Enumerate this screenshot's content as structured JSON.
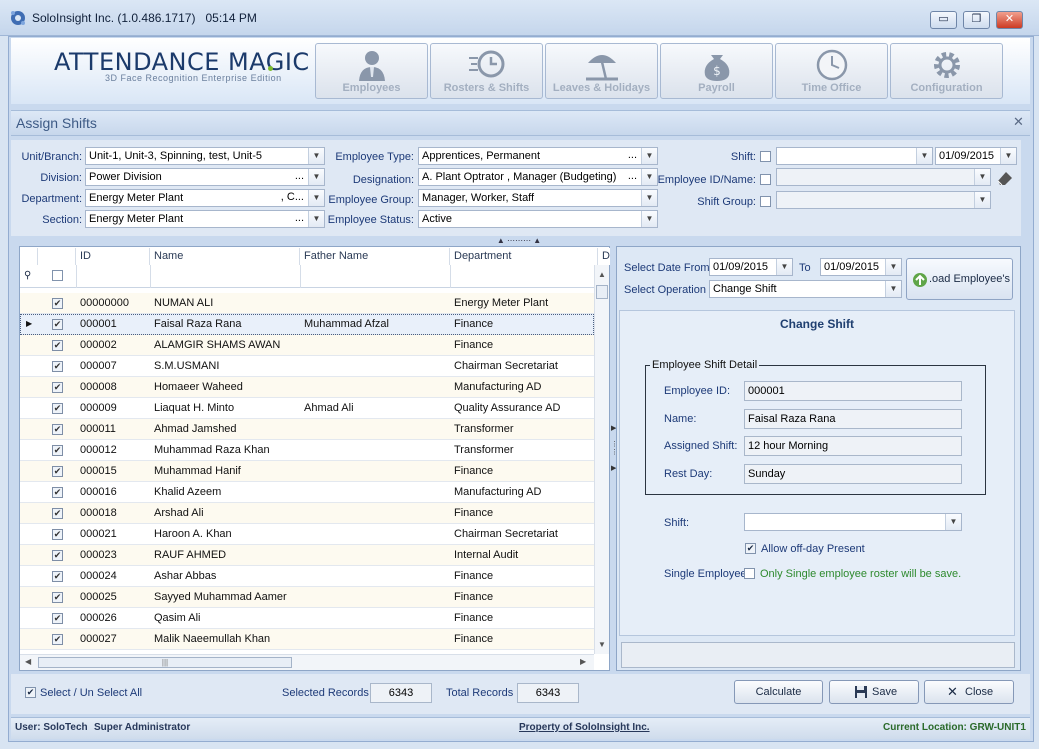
{
  "window": {
    "title": "SoloInsight Inc. (1.0.486.1717)",
    "time": "05:14 PM",
    "minimize": "▭",
    "restore": "❐",
    "close": "✕"
  },
  "brand": {
    "title": "ATTENDANCE MAGIC",
    "subtitle": "3D Face Recognition Enterprise Edition"
  },
  "nav": [
    {
      "label": "Employees",
      "icon": "employee-icon"
    },
    {
      "label": "Rosters & Shifts",
      "icon": "roster-clock-icon"
    },
    {
      "label": "Leaves & Holidays",
      "icon": "beach-umbrella-icon"
    },
    {
      "label": "Payroll",
      "icon": "money-bag-icon"
    },
    {
      "label": "Time Office",
      "icon": "wall-clock-icon"
    },
    {
      "label": "Configuration",
      "icon": "gear-icon"
    }
  ],
  "page": {
    "title": "Assign Shifts",
    "close": "✕"
  },
  "filters": {
    "unit_label": "Unit/Branch:",
    "unit_value": "Unit-1, Unit-3, Spinning, test, Unit-5",
    "division_label": "Division:",
    "division_value": "Power Division",
    "division_dots": "...",
    "department_label": "Department:",
    "department_value": "Energy Meter Plant",
    "department_more": ", C...",
    "section_label": "Section:",
    "section_value": "Energy Meter Plant",
    "section_dots": "...",
    "emp_type_label": "Employee Type:",
    "emp_type_value": "Apprentices, Permanent",
    "emp_type_dots": "...",
    "designation_label": "Designation:",
    "designation_value": "A. Plant Optrator , Manager (Budgeting)",
    "designation_dots": "...",
    "emp_group_label": "Employee Group:",
    "emp_group_value": "Manager, Worker, Staff",
    "emp_status_label": "Employee Status:",
    "emp_status_value": "Active",
    "shift_label": "Shift:",
    "shift_value": "",
    "shift_date": "01/09/2015",
    "emp_id_label": "Employee ID/Name:",
    "shift_group_label": "Shift Group:"
  },
  "grid": {
    "columns": [
      "ID",
      "Name",
      "Father Name",
      "Department",
      "D"
    ],
    "rows": [
      {
        "id": "00000000",
        "name": "NUMAN ALI",
        "father": "",
        "dept": "Energy Meter Plant"
      },
      {
        "id": "000001",
        "name": "Faisal Raza Rana",
        "father": "Muhammad Afzal",
        "dept": "Finance"
      },
      {
        "id": "000002",
        "name": "ALAMGIR SHAMS AWAN",
        "father": "",
        "dept": "Finance"
      },
      {
        "id": "000007",
        "name": "S.M.USMANI",
        "father": "",
        "dept": "Chairman Secretariat"
      },
      {
        "id": "000008",
        "name": "Homaeer Waheed",
        "father": "",
        "dept": "Manufacturing AD"
      },
      {
        "id": "000009",
        "name": "Liaquat H. Minto",
        "father": "Ahmad Ali",
        "dept": "Quality Assurance AD"
      },
      {
        "id": "000011",
        "name": "Ahmad Jamshed",
        "father": "",
        "dept": "Transformer"
      },
      {
        "id": "000012",
        "name": "Muhammad Raza Khan",
        "father": "",
        "dept": "Transformer"
      },
      {
        "id": "000015",
        "name": "Muhammad Hanif",
        "father": "",
        "dept": "Finance"
      },
      {
        "id": "000016",
        "name": "Khalid Azeem",
        "father": "",
        "dept": "Manufacturing AD"
      },
      {
        "id": "000018",
        "name": "Arshad Ali",
        "father": "",
        "dept": "Finance"
      },
      {
        "id": "000021",
        "name": "Haroon A. Khan",
        "father": "",
        "dept": "Chairman Secretariat"
      },
      {
        "id": "000023",
        "name": "RAUF  AHMED",
        "father": "",
        "dept": "Internal Audit"
      },
      {
        "id": "000024",
        "name": "Ashar Abbas",
        "father": "",
        "dept": "Finance"
      },
      {
        "id": "000025",
        "name": "Sayyed Muhammad Aamer",
        "father": "",
        "dept": "Finance"
      },
      {
        "id": "000026",
        "name": "Qasim Ali",
        "father": "",
        "dept": "Finance"
      },
      {
        "id": "000027",
        "name": "Malik Naeemullah Khan",
        "father": "",
        "dept": "Finance"
      }
    ]
  },
  "right": {
    "date_from_label": "Select Date From",
    "date_from": "01/09/2015",
    "to_label": "To",
    "date_to": "01/09/2015",
    "operation_label": "Select Operation",
    "operation_value": "Change Shift",
    "load_button": ".oad Employee's",
    "panel_title": "Change Shift",
    "detail_legend": "Employee Shift Detail",
    "emp_id_label": "Employee ID:",
    "emp_id": "000001",
    "name_label": "Name:",
    "name": "Faisal Raza Rana",
    "assigned_label": "Assigned Shift:",
    "assigned": "12 hour Morning",
    "rest_label": "Rest Day:",
    "rest": "Sunday",
    "shift_label": "Shift:",
    "allow_offday": "Allow off-day Present",
    "single_label": "Single Employee",
    "single_note": "Only Single employee roster will be save."
  },
  "bottom": {
    "select_all": "Select / Un Select All",
    "selected_label": "Selected Records",
    "selected_count": "6343",
    "total_label": "Total Records",
    "total_count": "6343",
    "calculate": "Calculate",
    "save": "Save",
    "close": "Close"
  },
  "status": {
    "user": "User: SoloTech",
    "role": "Super Administrator",
    "property": "Property of SoloInsight Inc.",
    "location": "Current Location: GRW-UNIT1"
  },
  "colors": {
    "accent": "#1b3a6b",
    "success_text": "#2e8a2e",
    "brand_green": "#7dbb2f"
  }
}
